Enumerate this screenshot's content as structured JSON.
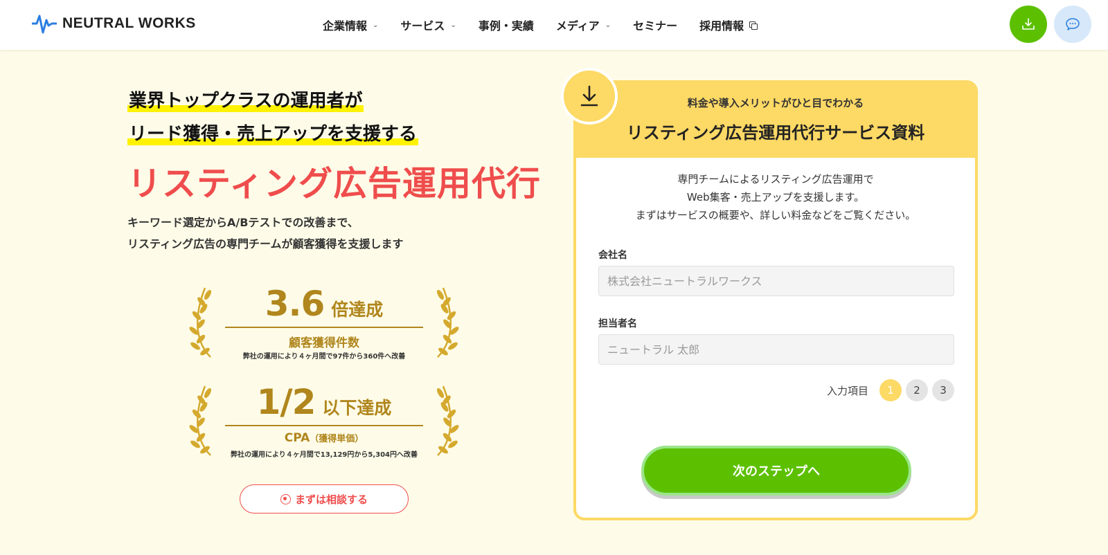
{
  "header": {
    "logo_text": "NEUTRAL WORKS",
    "nav": [
      {
        "label": "企業情報",
        "suffix": "chevron-down"
      },
      {
        "label": "サービス",
        "suffix": "chevron-down"
      },
      {
        "label": "事例・実績",
        "suffix": ""
      },
      {
        "label": "メディア",
        "suffix": "chevron-down"
      },
      {
        "label": "セミナー",
        "suffix": ""
      },
      {
        "label": "採用情報",
        "suffix": "external-link"
      }
    ],
    "download_icon": "download-icon",
    "chat_icon": "chat-icon",
    "colors": {
      "download_button": "#5cc000",
      "chat_button": "#d7e8fa"
    }
  },
  "hero": {
    "headline_line1": "業界トップクラスの運用者が",
    "headline_line2": "リード獲得・売上アップを支援する",
    "title": "リスティング広告運用代行",
    "subtitle_line1": "キーワード選定からA/Bテストでの改善まで、",
    "subtitle_line2": "リスティング広告の専門チームが顧客獲得を支援します",
    "accent_color": "#ef4d4d",
    "highlight_color": "#fff200"
  },
  "awards": [
    {
      "value": "3.6",
      "unit": "倍達成",
      "label": "顧客獲得件数",
      "label_small": "",
      "note": "弊社の運用により４ヶ月間で97件から360件へ改善"
    },
    {
      "value": "1/2",
      "unit": "以下達成",
      "label": "CPA",
      "label_small": "（獲得単価）",
      "note": "弊社の運用により４ヶ月間で13,129円から5,304円へ改善"
    }
  ],
  "cta": {
    "consult_label": "まずは相談する"
  },
  "form": {
    "kicker": "料金や導入メリットがひと目でわかる",
    "title": "リスティング広告運用代行サービス資料",
    "desc_line1": "専門チームによるリスティング広告運用で",
    "desc_line2": "Web集客・売上アップを支援します。",
    "desc_line3": "まずはサービスの概要や、詳しい料金などをご覧ください。",
    "company_label": "会社名",
    "company_placeholder": "株式会社ニュートラルワークス",
    "person_label": "担当者名",
    "person_placeholder": "ニュートラル 太郎",
    "steps_label": "入力項目",
    "steps": [
      "1",
      "2",
      "3"
    ],
    "current_step": 1,
    "next_label": "次のステップへ",
    "badge_icon": "download-icon",
    "colors": {
      "card": "#fdd965",
      "next_button": "#5cc000"
    }
  }
}
